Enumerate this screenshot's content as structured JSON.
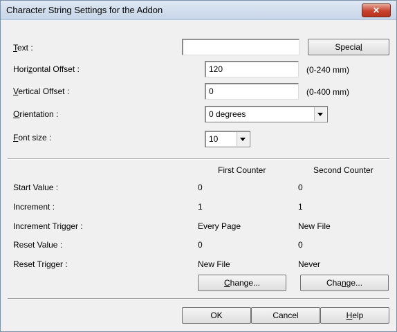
{
  "window": {
    "title": "Character String Settings for the Addon",
    "close_glyph": "✕"
  },
  "fields": {
    "text_label_pre": "",
    "text_label_mn": "T",
    "text_label_post": "ext :",
    "text_value": "",
    "special_pre": "Specia",
    "special_mn": "l",
    "special_post": "",
    "hoffset_pre": "Hori",
    "hoffset_mn": "z",
    "hoffset_post": "ontal Offset :",
    "hoffset_value": "120",
    "hoffset_range": "(0-240 mm)",
    "voffset_pre": "",
    "voffset_mn": "V",
    "voffset_post": "ertical Offset :",
    "voffset_value": "0",
    "voffset_range": "(0-400 mm)",
    "orientation_pre": "",
    "orientation_mn": "O",
    "orientation_post": "rientation :",
    "orientation_value": "0 degrees",
    "fontsize_pre": "",
    "fontsize_mn": "F",
    "fontsize_post": "ont size :",
    "fontsize_value": "10"
  },
  "counters": {
    "headers": {
      "first": "First Counter",
      "second": "Second Counter"
    },
    "rows": [
      {
        "label": "Start Value :",
        "first": "0",
        "second": "0"
      },
      {
        "label": "Increment :",
        "first": "1",
        "second": "1"
      },
      {
        "label": "Increment Trigger :",
        "first": "Every Page",
        "second": "New File"
      },
      {
        "label": "Reset Value :",
        "first": "0",
        "second": "0"
      },
      {
        "label": "Reset Trigger :",
        "first": "New File",
        "second": "Never"
      }
    ],
    "change1_pre": "",
    "change1_mn": "C",
    "change1_post": "hange...",
    "change2_pre": "Cha",
    "change2_mn": "n",
    "change2_post": "ge..."
  },
  "footer": {
    "ok": "OK",
    "cancel": "Cancel",
    "help_pre": "",
    "help_mn": "H",
    "help_post": "elp"
  }
}
